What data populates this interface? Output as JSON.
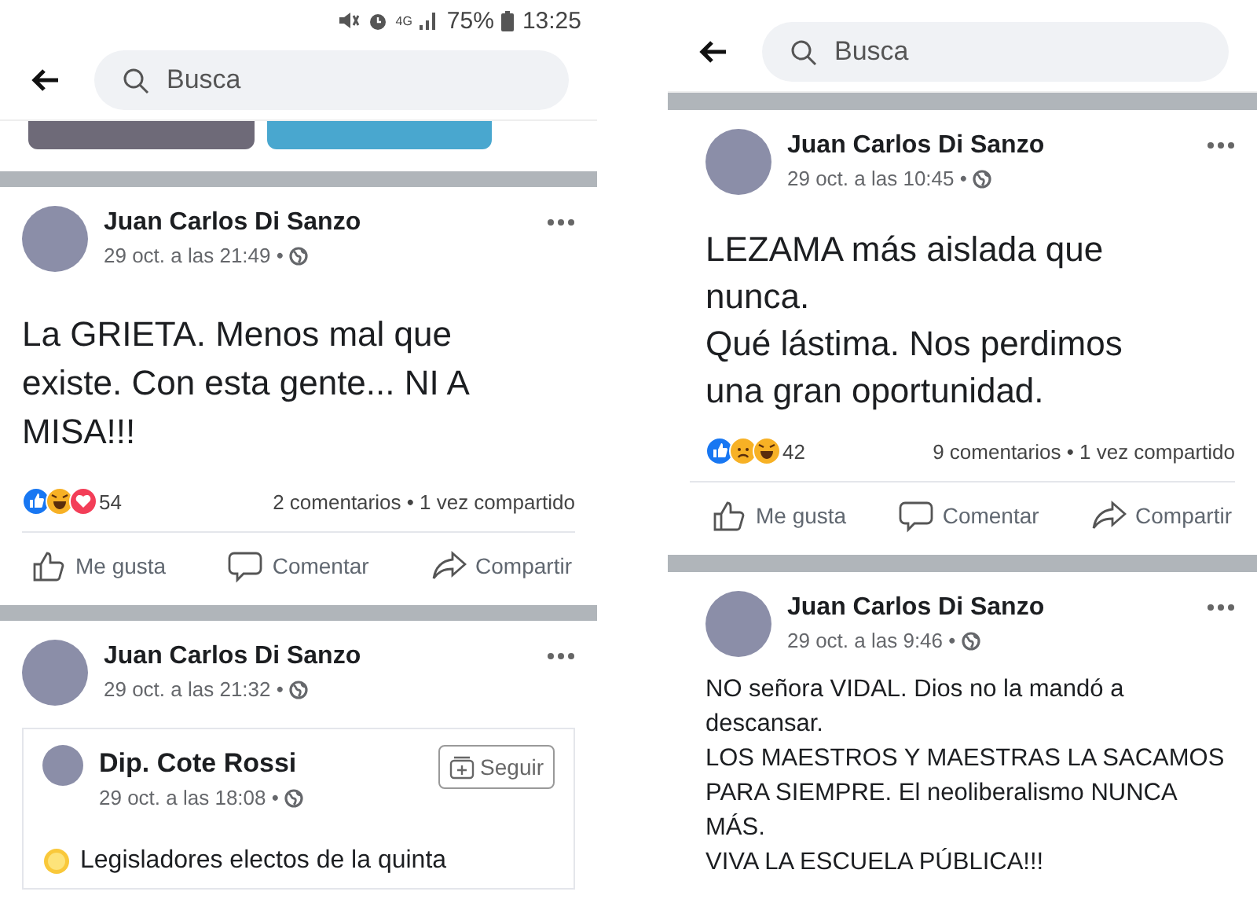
{
  "panels": [
    {
      "status_bar": {
        "network": "4G",
        "battery": "75%",
        "time": "13:25"
      },
      "search": {
        "placeholder": "Busca"
      },
      "preview": true,
      "posts": [
        {
          "author": "Juan Carlos Di Sanzo",
          "time": "29 oct. a las 21:49 •",
          "kind": "large_text",
          "text": "La GRIETA. Menos mal que\nexiste. Con esta gente... NI A\nMISA!!!",
          "reactions": [
            {
              "kind": "like"
            },
            {
              "kind": "haha"
            },
            {
              "kind": "love"
            }
          ],
          "reaction_count": "54",
          "stats": "2 comentarios • 1 vez compartido",
          "actions": [
            "Me gusta",
            "Comentar",
            "Compartir"
          ]
        },
        {
          "author": "Juan Carlos Di Sanzo",
          "time": "29 oct. a las 21:32 •",
          "kind": "shared",
          "shared": {
            "author": "Dip. Cote Rossi",
            "time": "29 oct. a las 18:08 •",
            "follow": "Seguir",
            "text": "Legisladores electos de la quinta"
          }
        }
      ]
    },
    {
      "search": {
        "placeholder": "Busca"
      },
      "preview": false,
      "posts": [
        {
          "author": "Juan Carlos Di Sanzo",
          "time": "29 oct. a las 10:45 •",
          "kind": "large_text",
          "text": "LEZAMA más aislada que\nnunca.\nQué lástima. Nos perdimos\nuna gran oportunidad.",
          "reactions": [
            {
              "kind": "like"
            },
            {
              "kind": "sad"
            },
            {
              "kind": "haha"
            }
          ],
          "reaction_count": "42",
          "stats": "9 comentarios • 1 vez compartido",
          "actions": [
            "Me gusta",
            "Comentar",
            "Compartir"
          ]
        },
        {
          "author": "Juan Carlos Di Sanzo",
          "time": "29 oct. a las 9:46 •",
          "kind": "text",
          "text": "NO señora VIDAL. Dios no la mandó a\ndescansar.\nLOS MAESTROS Y MAESTRAS LA SACAMOS\nPARA SIEMPRE. El neoliberalismo NUNCA\nMÁS.\nVIVA LA ESCUELA PÚBLICA!!!"
        }
      ]
    }
  ]
}
